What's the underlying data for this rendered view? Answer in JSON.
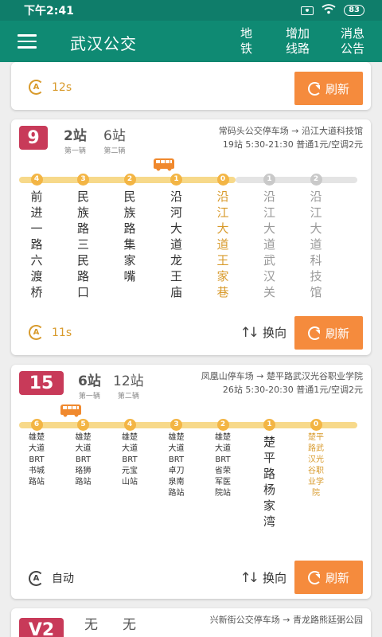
{
  "status_bar": {
    "time": "下午2:41",
    "battery": "83"
  },
  "app_bar": {
    "title": "武汉公交",
    "menu": [
      {
        "label": "地\n铁"
      },
      {
        "label": "增加\n线路"
      },
      {
        "label": "消息\n公告"
      }
    ]
  },
  "colors": {
    "accent": "#0f8a73",
    "badge": "#c83a59",
    "orange": "#f58b3d",
    "current_stop": "#d89a2b"
  },
  "card_top": {
    "timer": "12s",
    "refresh_label": "刷新"
  },
  "routes": [
    {
      "number": "9",
      "first_bus_stops": "2站",
      "first_bus_label": "第一辆",
      "second_bus_stops": "6站",
      "second_bus_label": "第二辆",
      "direction": "常码头公交停车场 → 沿江大道科技馆",
      "details": "19站  5:30-21:30  普通1元/空调2元",
      "stops": [
        {
          "count": "4",
          "name": "前进一路六渡桥",
          "state": "passed"
        },
        {
          "count": "3",
          "name": "民族路三民路口",
          "state": "passed"
        },
        {
          "count": "2",
          "name": "民族路集家嘴",
          "state": "passed"
        },
        {
          "count": "1",
          "name": "沿河大道龙王庙",
          "state": "passed"
        },
        {
          "count": "0",
          "name": "沿江大道王家巷",
          "state": "current"
        },
        {
          "count": "1",
          "name": "沿江大道武汉关",
          "state": "ahead"
        },
        {
          "count": "2",
          "name": "沿江大道科技馆",
          "state": "ahead"
        }
      ],
      "timer": "11s",
      "swap_label": "换向",
      "refresh_label": "刷新"
    },
    {
      "number": "15",
      "first_bus_stops": "6站",
      "first_bus_label": "第一辆",
      "second_bus_stops": "12站",
      "second_bus_label": "第二辆",
      "direction": "凤凰山停车场 → 楚平路武汉光谷职业学院",
      "details": "26站  5:30-20:30  普通1元/空调2元",
      "stops": [
        {
          "count": "6",
          "name": "雄楚大道BRT书城路站",
          "state": "passed"
        },
        {
          "count": "5",
          "name": "雄楚大道BRT珞狮路站",
          "state": "passed"
        },
        {
          "count": "4",
          "name": "雄楚大道BRT元宝山站",
          "state": "passed"
        },
        {
          "count": "3",
          "name": "雄楚大道BRT卓刀泉南路站",
          "state": "passed"
        },
        {
          "count": "2",
          "name": "雄楚大道BRT省荣军医院站",
          "state": "passed"
        },
        {
          "count": "1",
          "name": "楚平路杨家湾",
          "state": "passed"
        },
        {
          "count": "0",
          "name": "楚平路武汉光谷职业学院",
          "state": "current"
        }
      ],
      "timer": "自动",
      "swap_label": "换向",
      "refresh_label": "刷新"
    },
    {
      "number": "V2",
      "first_bus_stops": "无",
      "second_bus_stops": "无",
      "direction": "兴新街公交停车场 → 青龙路熊廷弼公园"
    }
  ]
}
